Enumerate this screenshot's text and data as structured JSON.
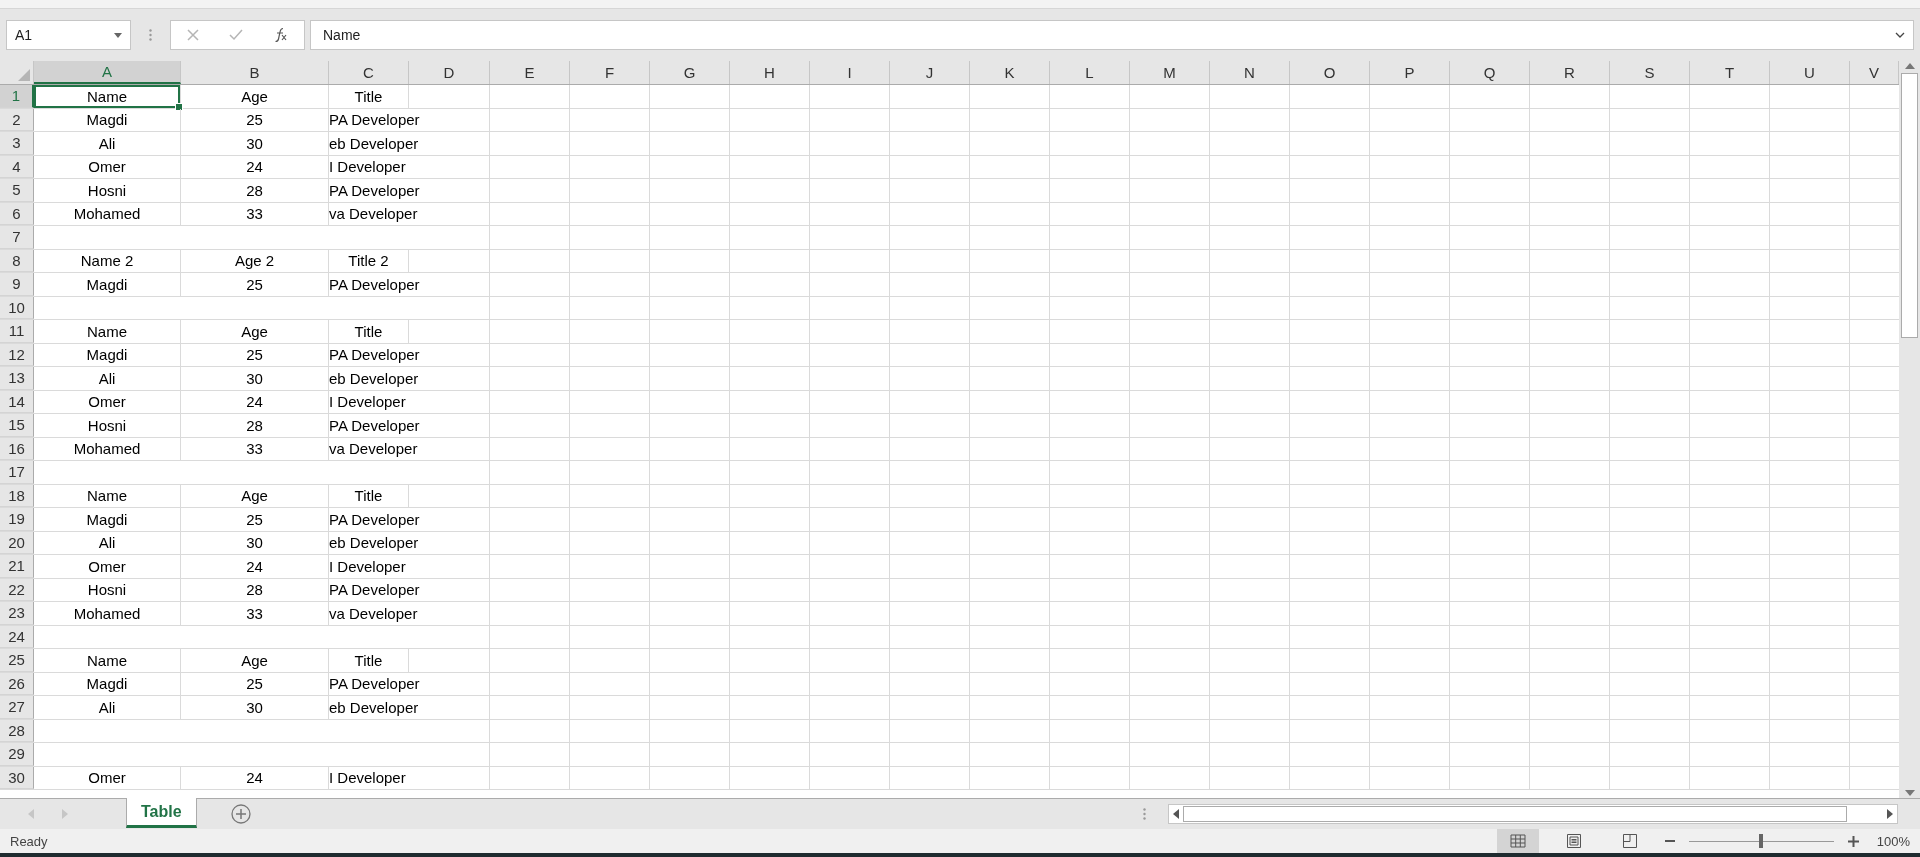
{
  "name_box": {
    "value": "A1"
  },
  "formula_bar": {
    "value": "Name"
  },
  "columns": [
    {
      "label": "A",
      "selected": true
    },
    {
      "label": "B",
      "selected": false
    },
    {
      "label": "C",
      "selected": false
    },
    {
      "label": "D",
      "selected": false
    },
    {
      "label": "E",
      "selected": false
    },
    {
      "label": "F",
      "selected": false
    },
    {
      "label": "G",
      "selected": false
    },
    {
      "label": "H",
      "selected": false
    },
    {
      "label": "I",
      "selected": false
    },
    {
      "label": "J",
      "selected": false
    },
    {
      "label": "K",
      "selected": false
    },
    {
      "label": "L",
      "selected": false
    },
    {
      "label": "M",
      "selected": false
    },
    {
      "label": "N",
      "selected": false
    },
    {
      "label": "O",
      "selected": false
    },
    {
      "label": "P",
      "selected": false
    },
    {
      "label": "Q",
      "selected": false
    },
    {
      "label": "R",
      "selected": false
    },
    {
      "label": "S",
      "selected": false
    },
    {
      "label": "T",
      "selected": false
    },
    {
      "label": "U",
      "selected": false
    },
    {
      "label": "V",
      "selected": false
    }
  ],
  "rows": [
    {
      "number": "1",
      "selected": true,
      "kind": "header",
      "cells": [
        "Name",
        "Age",
        "Title"
      ]
    },
    {
      "number": "2",
      "selected": false,
      "kind": "data",
      "cells": [
        "Magdi",
        "25",
        "PA Developer"
      ]
    },
    {
      "number": "3",
      "selected": false,
      "kind": "data",
      "cells": [
        "Ali",
        "30",
        "eb Developer"
      ]
    },
    {
      "number": "4",
      "selected": false,
      "kind": "data",
      "cells": [
        "Omer",
        "24",
        "I Developer"
      ]
    },
    {
      "number": "5",
      "selected": false,
      "kind": "data",
      "cells": [
        "Hosni",
        "28",
        "PA Developer"
      ]
    },
    {
      "number": "6",
      "selected": false,
      "kind": "data",
      "cells": [
        "Mohamed",
        "33",
        "va Developer"
      ]
    },
    {
      "number": "7",
      "selected": false,
      "kind": "blank"
    },
    {
      "number": "8",
      "selected": false,
      "kind": "header",
      "cells": [
        "Name 2",
        "Age 2",
        "Title 2"
      ]
    },
    {
      "number": "9",
      "selected": false,
      "kind": "data",
      "cells": [
        "Magdi",
        "25",
        "PA Developer"
      ]
    },
    {
      "number": "10",
      "selected": false,
      "kind": "blank"
    },
    {
      "number": "11",
      "selected": false,
      "kind": "header",
      "cells": [
        "Name",
        "Age",
        "Title"
      ]
    },
    {
      "number": "12",
      "selected": false,
      "kind": "data",
      "cells": [
        "Magdi",
        "25",
        "PA Developer"
      ]
    },
    {
      "number": "13",
      "selected": false,
      "kind": "data",
      "cells": [
        "Ali",
        "30",
        "eb Developer"
      ]
    },
    {
      "number": "14",
      "selected": false,
      "kind": "data",
      "cells": [
        "Omer",
        "24",
        "I Developer"
      ]
    },
    {
      "number": "15",
      "selected": false,
      "kind": "data",
      "cells": [
        "Hosni",
        "28",
        "PA Developer"
      ]
    },
    {
      "number": "16",
      "selected": false,
      "kind": "data",
      "cells": [
        "Mohamed",
        "33",
        "va Developer"
      ]
    },
    {
      "number": "17",
      "selected": false,
      "kind": "blank"
    },
    {
      "number": "18",
      "selected": false,
      "kind": "header",
      "cells": [
        "Name",
        "Age",
        "Title"
      ]
    },
    {
      "number": "19",
      "selected": false,
      "kind": "data",
      "cells": [
        "Magdi",
        "25",
        "PA Developer"
      ]
    },
    {
      "number": "20",
      "selected": false,
      "kind": "data",
      "cells": [
        "Ali",
        "30",
        "eb Developer"
      ]
    },
    {
      "number": "21",
      "selected": false,
      "kind": "data",
      "cells": [
        "Omer",
        "24",
        "I Developer"
      ]
    },
    {
      "number": "22",
      "selected": false,
      "kind": "data",
      "cells": [
        "Hosni",
        "28",
        "PA Developer"
      ]
    },
    {
      "number": "23",
      "selected": false,
      "kind": "data",
      "cells": [
        "Mohamed",
        "33",
        "va Developer"
      ]
    },
    {
      "number": "24",
      "selected": false,
      "kind": "blank"
    },
    {
      "number": "25",
      "selected": false,
      "kind": "header",
      "cells": [
        "Name",
        "Age",
        "Title"
      ]
    },
    {
      "number": "26",
      "selected": false,
      "kind": "data",
      "cells": [
        "Magdi",
        "25",
        "PA Developer"
      ]
    },
    {
      "number": "27",
      "selected": false,
      "kind": "data",
      "cells": [
        "Ali",
        "30",
        "eb Developer"
      ]
    },
    {
      "number": "28",
      "selected": false,
      "kind": "blank"
    },
    {
      "number": "29",
      "selected": false,
      "kind": "blank"
    },
    {
      "number": "30",
      "selected": false,
      "kind": "data",
      "cells": [
        "Omer",
        "24",
        "I Developer"
      ]
    }
  ],
  "sheet_tabs": [
    {
      "label": "Table",
      "selected": true
    }
  ],
  "status_bar": {
    "status": "Ready",
    "view_buttons": [
      {
        "kind": "normal",
        "selected": true
      },
      {
        "kind": "page-layout",
        "selected": false
      },
      {
        "kind": "page-break",
        "selected": false
      }
    ],
    "zoom_slider": {
      "level": 0.5
    },
    "zoom": "100%"
  }
}
